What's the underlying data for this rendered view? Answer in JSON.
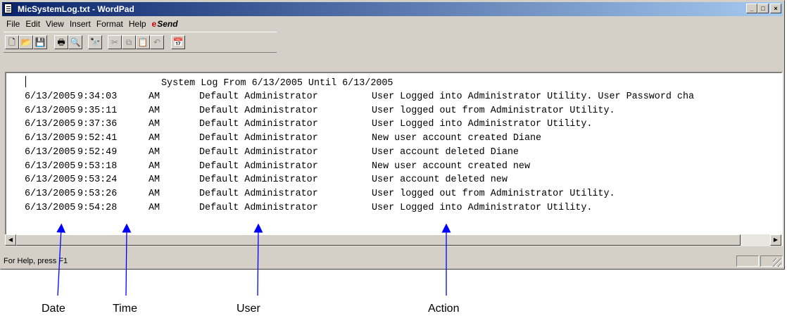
{
  "window": {
    "title": "MicSystemLog.txt - WordPad",
    "buttons": {
      "minimize": "_",
      "maximize": "□",
      "close": "×"
    }
  },
  "menu": [
    "File",
    "Edit",
    "View",
    "Insert",
    "Format",
    "Help"
  ],
  "send_label": "Send",
  "toolbar": [
    {
      "name": "new-icon",
      "glyph": "🗋"
    },
    {
      "name": "open-icon",
      "glyph": "📂"
    },
    {
      "name": "save-icon",
      "glyph": "💾"
    },
    {
      "name": "print-icon",
      "glyph": "🖶"
    },
    {
      "name": "print-preview-icon",
      "glyph": "🔍"
    },
    {
      "name": "find-icon",
      "glyph": "🔭"
    },
    {
      "name": "cut-icon",
      "glyph": "✂"
    },
    {
      "name": "copy-icon",
      "glyph": "⧉"
    },
    {
      "name": "paste-icon",
      "glyph": "📋"
    },
    {
      "name": "undo-icon",
      "glyph": "↶"
    },
    {
      "name": "insert-datetime-icon",
      "glyph": "📅"
    }
  ],
  "log": {
    "title": "System Log From 6/13/2005 Until 6/13/2005",
    "rows": [
      {
        "date": "6/13/2005",
        "time": "9:34:03",
        "ampm": "AM",
        "user": "Default Administrator",
        "action": "User Logged into Administrator Utility. User Password cha"
      },
      {
        "date": "6/13/2005",
        "time": "9:35:11",
        "ampm": "AM",
        "user": "Default Administrator",
        "action": "User logged out from Administrator Utility."
      },
      {
        "date": "6/13/2005",
        "time": "9:37:36",
        "ampm": "AM",
        "user": "Default Administrator",
        "action": "User Logged into Administrator Utility."
      },
      {
        "date": "6/13/2005",
        "time": "9:52:41",
        "ampm": "AM",
        "user": "Default Administrator",
        "action": "New user account created Diane"
      },
      {
        "date": "6/13/2005",
        "time": "9:52:49",
        "ampm": "AM",
        "user": "Default Administrator",
        "action": "User account deleted Diane"
      },
      {
        "date": "6/13/2005",
        "time": "9:53:18",
        "ampm": "AM",
        "user": "Default Administrator",
        "action": "New user account created new"
      },
      {
        "date": "6/13/2005",
        "time": "9:53:24",
        "ampm": "AM",
        "user": "Default Administrator",
        "action": "User account deleted new"
      },
      {
        "date": "6/13/2005",
        "time": "9:53:26",
        "ampm": "AM",
        "user": "Default Administrator",
        "action": "User logged out from Administrator Utility."
      },
      {
        "date": "6/13/2005",
        "time": "9:54:28",
        "ampm": "AM",
        "user": "Default Administrator",
        "action": "User Logged into Administrator Utility."
      }
    ]
  },
  "status": {
    "text": "For Help, press F1"
  },
  "annotations": [
    "Date",
    "Time",
    "User",
    "Action"
  ],
  "colors": {
    "arrow": "#0000ff",
    "titlebar_start": "#0a246a",
    "titlebar_end": "#a6caf0"
  }
}
